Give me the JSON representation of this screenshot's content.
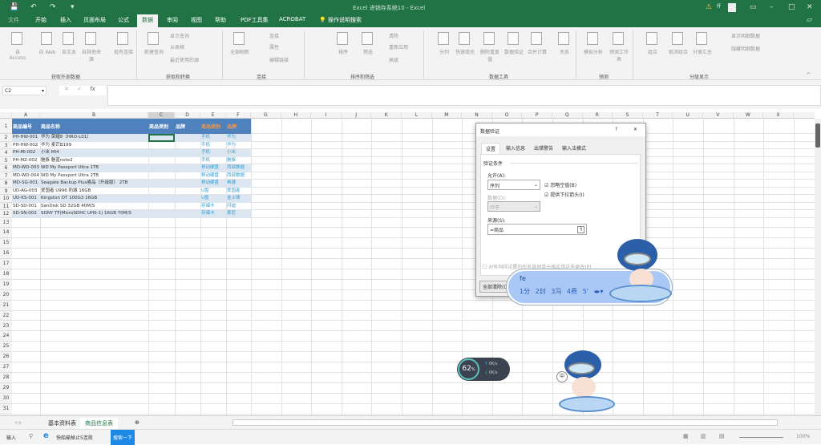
{
  "window": {
    "title": "Excel 进销存系统10 - Excel",
    "user": "ff"
  },
  "quick_access": {
    "save": "💾",
    "undo": "↶",
    "redo": "↷",
    "customize": "▾"
  },
  "tabs": [
    "文件",
    "开始",
    "插入",
    "页面布局",
    "公式",
    "数据",
    "审阅",
    "视图",
    "帮助",
    "PDF工具集",
    "ACROBAT",
    "操作说明搜索"
  ],
  "ribbon": {
    "buttons": [
      "自 Access",
      "自 Web",
      "自文本",
      "自其他来源",
      "现有连接",
      "新建查询",
      "全部刷新",
      "排序",
      "筛选",
      "分列",
      "快速填充",
      "删除重复值",
      "数据验证",
      "合并计算",
      "关系",
      "模拟分析",
      "预测工作表",
      "组合",
      "取消组合",
      "分类汇总"
    ],
    "small": [
      "显示查询",
      "从表格",
      "最近使用的源",
      "连接",
      "属性",
      "编辑链接",
      "清除",
      "重新应用",
      "高级",
      "显示明细数据",
      "隐藏明细数据"
    ],
    "groups": [
      "获取外部数据",
      "获取和转换",
      "连接",
      "排序和筛选",
      "数据工具",
      "预测",
      "分级显示"
    ]
  },
  "formula_bar": {
    "name_box": "C2",
    "value": ""
  },
  "columns": [
    "A",
    "B",
    "C",
    "D",
    "E",
    "F",
    "G",
    "H",
    "I",
    "J",
    "K",
    "L",
    "M",
    "N",
    "O",
    "P",
    "Q",
    "R",
    "S",
    "T",
    "U",
    "V",
    "W",
    "X"
  ],
  "header_row": [
    "商品编号",
    "商品名称",
    "商品类别",
    "品牌",
    "商品类别",
    "品牌"
  ],
  "rows": [
    [
      "PH-HW-001",
      "华为 荣耀8（HRO-L01）",
      "",
      "",
      "手机",
      "华为"
    ],
    [
      "PH-HW-002",
      "华为 麦芒B199",
      "",
      "",
      "手机",
      "华为"
    ],
    [
      "PH-MI-002",
      "小米 MI4",
      "",
      "",
      "手机",
      "小米"
    ],
    [
      "PH-MZ-002",
      "魅族 魅蓝note2",
      "",
      "",
      "手机",
      "魅族"
    ],
    [
      "MD-WD-003",
      "WD My Passport Ultra 1TB",
      "",
      "",
      "移动硬盘",
      "西部数据"
    ],
    [
      "MD-WD-004",
      "WD My Passport Ultra 2TB",
      "",
      "",
      "移动硬盘",
      "西部数据"
    ],
    [
      "MD-SG-001",
      "Seagate Backup Plus睿品（升级版） 2TB",
      "",
      "",
      "移动硬盘",
      "希捷"
    ],
    [
      "UD-AG-003",
      "爱国者 U996 豹城 16GB",
      "",
      "",
      "U盘",
      "爱国者"
    ],
    [
      "UD-KS-001",
      "Kingston DT 100G3 16GB",
      "",
      "",
      "U盘",
      "金士顿"
    ],
    [
      "SD-SD-001",
      "SanDisk SD 32GB 40M/S",
      "",
      "",
      "存储卡",
      "闪迪"
    ],
    [
      "SD-SN-002",
      "SONY TF(MicroSDHC UHS-1) 16GB 70M/S",
      "",
      "",
      "存储卡",
      "索尼"
    ]
  ],
  "sheet_tabs": [
    "基本资料表",
    "商品信息表"
  ],
  "status": {
    "mode": "输入",
    "news": "快船输掉止5连败",
    "search": "搜索一下",
    "zoom": "100%"
  },
  "dialog": {
    "title": "数据验证",
    "help": "?",
    "close": "✕",
    "tabs": [
      "设置",
      "输入信息",
      "出错警告",
      "输入法模式"
    ],
    "section": "验证条件",
    "allow_label": "允许(A):",
    "allow_value": "序列",
    "ignore_blank": "忽略空值(B)",
    "dropdown": "提供下拉箭头(I)",
    "data_label": "数据(D):",
    "data_value": "介于",
    "source_label": "来源(S):",
    "source_value": "=商品",
    "apply_all": "对有同样设置的所有其他单元格应用这些更改(P)",
    "clear_all": "全部清除(C)"
  },
  "ime": {
    "input": "fe",
    "candidates": [
      "1分",
      "2封",
      "3冯",
      "4费",
      "5'"
    ]
  },
  "monitor": {
    "percent": "62",
    "unit": "%",
    "up": "0K/s",
    "down": "0K/s"
  },
  "mascot": {
    "mode": "中"
  }
}
